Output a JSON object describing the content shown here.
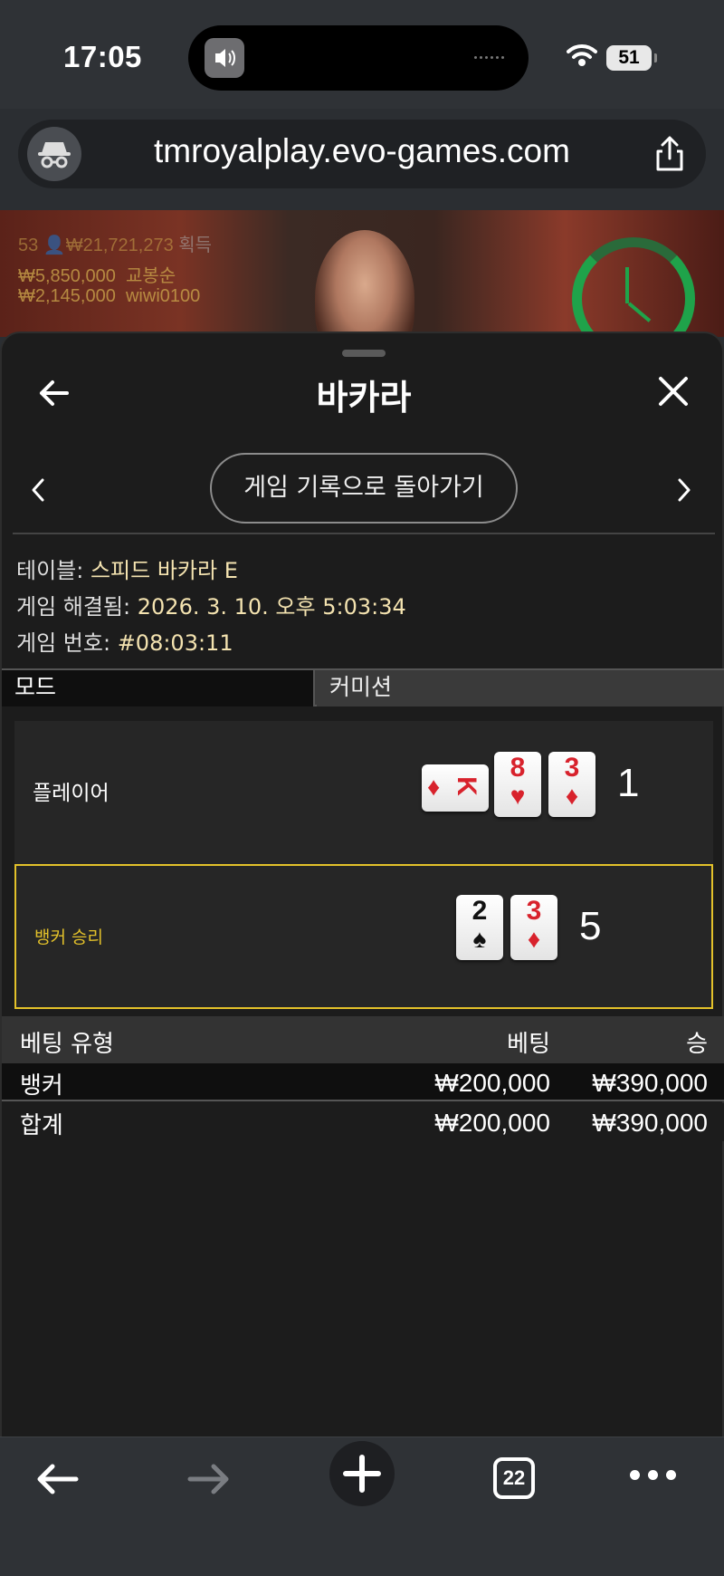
{
  "status_bar": {
    "time": "17:05",
    "battery": "51"
  },
  "browser": {
    "url": "tmroyalplay.evo-games.com"
  },
  "video": {
    "row1": {
      "count": "53",
      "amount": "₩21,721,273",
      "label": "획득"
    },
    "row2": {
      "amount": "₩5,850,000",
      "user": "교봉순"
    },
    "row3": {
      "amount": "₩2,145,000",
      "user": "wiwi0100"
    }
  },
  "sheet": {
    "title": "바카라",
    "back_to_history": "게임 기록으로 돌아가기",
    "info": {
      "table_label": "테이블:",
      "table_value": "스피드 바카라 E",
      "resolved_label": "게임 해결됨:",
      "resolved_value": "2026. 3. 10. 오후 5:03:34",
      "game_no_label": "게임 번호:",
      "game_no_value": "#08:03:11"
    },
    "tabs": {
      "mode": "모드",
      "commission": "커미션"
    },
    "player": {
      "label": "플레이어",
      "score": "1",
      "cards": [
        {
          "rank": "K",
          "suit": "♦",
          "color": "#d8222c",
          "sideways": true
        },
        {
          "rank": "8",
          "suit": "♥",
          "color": "#d8222c"
        },
        {
          "rank": "3",
          "suit": "♦",
          "color": "#d8222c"
        }
      ]
    },
    "banker": {
      "label": "뱅커 승리",
      "score": "5",
      "cards": [
        {
          "rank": "2",
          "suit": "♠",
          "color": "#111111"
        },
        {
          "rank": "3",
          "suit": "♦",
          "color": "#d8222c"
        }
      ]
    },
    "bets": {
      "headers": {
        "type": "베팅 유형",
        "bet": "베팅",
        "win": "승"
      },
      "rows": [
        {
          "type": "뱅커",
          "bet": "₩200,000",
          "win": "₩390,000"
        }
      ],
      "total": {
        "type": "합계",
        "bet": "₩200,000",
        "win": "₩390,000"
      }
    }
  },
  "toolbar": {
    "tab_count": "22"
  },
  "colors": {
    "win_highlight": "#e3c12a",
    "timer_green": "#1fa34a",
    "card_red": "#d8222c"
  }
}
